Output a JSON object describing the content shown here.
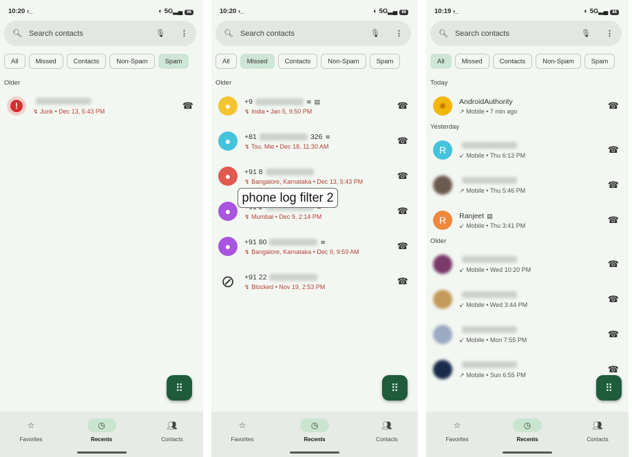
{
  "caption": "phone log filter 2",
  "colors": {
    "missed": "#b3413a",
    "normal": "#555555",
    "accent": "#1f5c3c",
    "chip_selected": "#cfe6d6"
  },
  "nav": {
    "items": [
      {
        "label": "Favorites",
        "icon": "star-icon"
      },
      {
        "label": "Recents",
        "icon": "clock-icon"
      },
      {
        "label": "Contacts",
        "icon": "contacts-icon"
      }
    ]
  },
  "panels": [
    {
      "time": "10:20",
      "network": "5G",
      "battery": "86",
      "search_placeholder": "Search contacts",
      "chips": [
        "All",
        "Missed",
        "Contacts",
        "Non-Spam",
        "Spam"
      ],
      "selected_chip": "Spam",
      "sections": [
        {
          "title": "Older",
          "items": [
            {
              "avatar": "spam",
              "color": "#d32f2f",
              "name": "",
              "meta": "Junk • Dec 13, 5:43 PM",
              "type": "missed"
            }
          ]
        }
      ]
    },
    {
      "time": "10:20",
      "network": "5G",
      "battery": "86",
      "search_placeholder": "Search contacts",
      "chips": [
        "All",
        "Missed",
        "Contacts",
        "Non-Spam",
        "Spam"
      ],
      "selected_chip": "Missed",
      "sections": [
        {
          "title": "Older",
          "items": [
            {
              "avatar": "person",
              "color": "#f4c430",
              "name": "+9",
              "meta": "India • Jan 5, 9:50 PM",
              "type": "missed",
              "wifi": true,
              "sim": true
            },
            {
              "avatar": "person",
              "color": "#45c3dc",
              "name": "+81",
              "name_suffix": "326",
              "meta": "Tsu, Mie • Dec 18, 11:30 AM",
              "type": "missed",
              "wifi": true
            },
            {
              "avatar": "person",
              "color": "#e05a50",
              "name": "+91 8",
              "meta": "Bangalore, Karnataka • Dec 13, 5:43 PM",
              "type": "missed"
            },
            {
              "avatar": "person",
              "color": "#a855e0",
              "name": "+91 2",
              "meta": "Mumbai • Dec 9, 2:14 PM",
              "type": "missed",
              "wifi": true
            },
            {
              "avatar": "person",
              "color": "#a855e0",
              "name": "+91 80",
              "meta": "Bangalore, Karnataka • Dec 9, 9:59 AM",
              "type": "missed",
              "wifi": true
            },
            {
              "avatar": "blocked",
              "color": "#333333",
              "name": "+91 22",
              "meta": "Blocked • Nov 19, 2:53 PM",
              "type": "missed"
            }
          ]
        }
      ]
    },
    {
      "time": "10:19",
      "network": "5G",
      "battery": "86",
      "search_placeholder": "Search contacts",
      "chips": [
        "All",
        "Missed",
        "Contacts",
        "Non-Spam",
        "Spam"
      ],
      "selected_chip": "All",
      "sections": [
        {
          "title": "Today",
          "items": [
            {
              "avatar": "logo",
              "color": "#f2b705",
              "name": "AndroidAuthority",
              "meta": "Mobile • 7 min ago",
              "type": "outgoing",
              "noblur": true
            }
          ]
        },
        {
          "title": "Yesterday",
          "items": [
            {
              "avatar": "letter",
              "letter": "R",
              "color": "#45c3dc",
              "name": "",
              "meta": "Mobile • Thu 6:13 PM",
              "type": "incoming"
            },
            {
              "avatar": "photo",
              "color": "#6b5a4e",
              "name": "",
              "meta": "Mobile • Thu 5:46 PM",
              "type": "outgoing"
            },
            {
              "avatar": "letter",
              "letter": "R",
              "color": "#f0883e",
              "name": "Ranjeet",
              "meta": "Mobile • Thu 3:41 PM",
              "type": "incoming",
              "sim": true,
              "noblur": true
            }
          ]
        },
        {
          "title": "Older",
          "items": [
            {
              "avatar": "photo",
              "color": "#7a3a6a",
              "name": "",
              "meta": "Mobile • Wed 10:20 PM",
              "type": "incoming"
            },
            {
              "avatar": "photo",
              "color": "#c49a5a",
              "name": "",
              "meta": "Mobile • Wed 3:44 PM",
              "type": "incoming"
            },
            {
              "avatar": "photo",
              "color": "#9aaac4",
              "name": "",
              "meta": "Mobile • Mon 7:55 PM",
              "type": "incoming"
            },
            {
              "avatar": "photo",
              "color": "#1a2a4a",
              "name": "",
              "meta": "Mobile • Sun 6:55 PM",
              "type": "outgoing"
            }
          ]
        }
      ]
    }
  ]
}
